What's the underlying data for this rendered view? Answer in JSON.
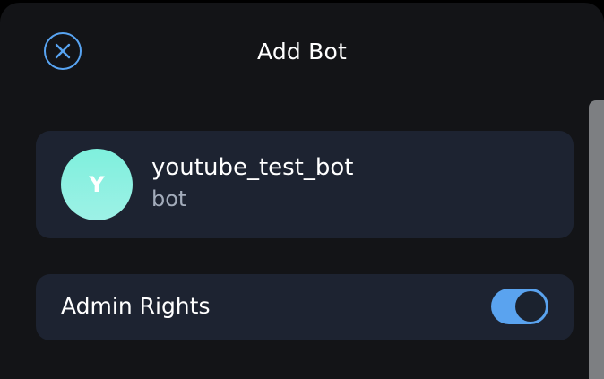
{
  "header": {
    "title": "Add Bot",
    "close_icon": "close-circle-icon",
    "accent_color": "#58a4f2"
  },
  "bot": {
    "avatar_letter": "Y",
    "name": "youtube_test_bot",
    "subtitle": "bot",
    "avatar_color": "#8ef0e0"
  },
  "admin_rights": {
    "label": "Admin Rights",
    "enabled": true,
    "toggle_color": "#5aa3ef"
  }
}
